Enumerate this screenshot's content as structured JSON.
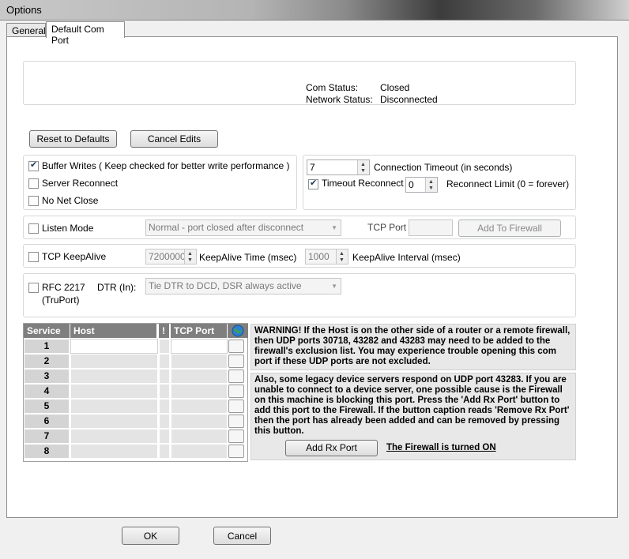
{
  "window": {
    "title": "Options"
  },
  "tabs": [
    {
      "label": "General"
    },
    {
      "label": "Default Com Port"
    }
  ],
  "status": {
    "com_status_label": "Com Status:",
    "com_status_value": "Closed",
    "network_status_label": "Network Status:",
    "network_status_value": "Disconnected"
  },
  "buttons": {
    "reset": "Reset to Defaults",
    "cancel_edits": "Cancel Edits",
    "add_firewall": "Add To Firewall",
    "add_rx_port": "Add Rx Port",
    "ok": "OK",
    "cancel": "Cancel"
  },
  "options": {
    "buffer_writes": "Buffer Writes",
    "buffer_writes_note": "( Keep checked for better write performance )",
    "server_reconnect": "Server Reconnect",
    "no_net_close": "No Net Close",
    "connection_timeout_value": "7",
    "connection_timeout_label": "Connection Timeout (in seconds)",
    "timeout_reconnect": "Timeout Reconnect",
    "reconnect_limit_value": "0",
    "reconnect_limit_label": "Reconnect Limit (0 = forever)"
  },
  "listen": {
    "label": "Listen Mode",
    "mode_value": "Normal - port closed after disconnect",
    "tcp_port_label": "TCP Port"
  },
  "keepalive": {
    "label": "TCP KeepAlive",
    "time_value": "7200000",
    "time_label": "KeepAlive Time (msec)",
    "interval_value": "1000",
    "interval_label": "KeepAlive Interval (msec)"
  },
  "rfc": {
    "label_line1": "RFC 2217",
    "label_line2": "(TruPort)",
    "dtr_label": "DTR (In):",
    "dtr_value": "Tie DTR to DCD, DSR always active"
  },
  "grid": {
    "headers": [
      "Service",
      "Host",
      "!",
      "TCP Port"
    ],
    "rows": [
      "1",
      "2",
      "3",
      "4",
      "5",
      "6",
      "7",
      "8"
    ]
  },
  "warning_text": "WARNING!  If the Host is on the other side of a router or a remote firewall, then UDP ports 30718, 43282 and 43283 may need to be added to the firewall's exclusion list.  You may experience trouble opening this com port if these UDP ports are not excluded.",
  "legacy_text": "Also, some legacy device servers respond on UDP port 43283.  If you are unable to connect to a device server, one possible cause is the Firewall on this machine is blocking this port.  Press the 'Add Rx Port' button to add this port to the Firewall.   If the button caption reads 'Remove Rx Port' then the port has already been added and can be removed by pressing this button.",
  "firewall_status": "The Firewall is turned ON",
  "colors": {
    "grid_header": "#7f7f7f",
    "globe": "#2a7fd4"
  }
}
